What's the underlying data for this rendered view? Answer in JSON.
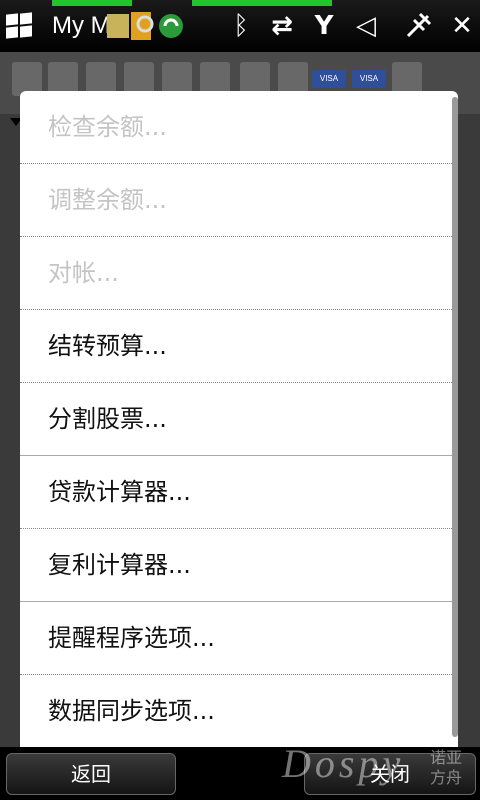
{
  "status_bar": {
    "app_title": "My M",
    "icons": [
      "windows-logo-icon",
      "notification-icon",
      "bluetooth-icon",
      "data-transfer-icon",
      "signal-icon",
      "volume-mute-icon",
      "power-plug-icon",
      "close-icon"
    ],
    "close_glyph": "✕",
    "bluetooth_glyph": "ᛒ",
    "transfer_glyph": "⇄",
    "signal_glyph": "Y",
    "volume_glyph": "◁"
  },
  "toolbar": {
    "visa_1": "VISA",
    "visa_2": "VISA"
  },
  "menu": {
    "items": [
      {
        "label": "检查余额...",
        "enabled": false
      },
      {
        "label": "调整余额...",
        "enabled": false
      },
      {
        "label": "对帐...",
        "enabled": false
      },
      {
        "label": "结转预算...",
        "enabled": true
      },
      {
        "label": "分割股票...",
        "enabled": true
      },
      {
        "label": "贷款计算器...",
        "enabled": true
      },
      {
        "label": "复利计算器...",
        "enabled": true
      },
      {
        "label": "提醒程序选项...",
        "enabled": true
      },
      {
        "label": "数据同步选项...",
        "enabled": true
      }
    ]
  },
  "softkeys": {
    "left": "返回",
    "right": "关闭"
  },
  "watermark": {
    "brand": "Dospy",
    "cn": "诺亚方舟"
  },
  "colors": {
    "signal_green": "#22c52a",
    "menu_bg": "#ffffff",
    "disabled_text": "#c4c4c4"
  }
}
